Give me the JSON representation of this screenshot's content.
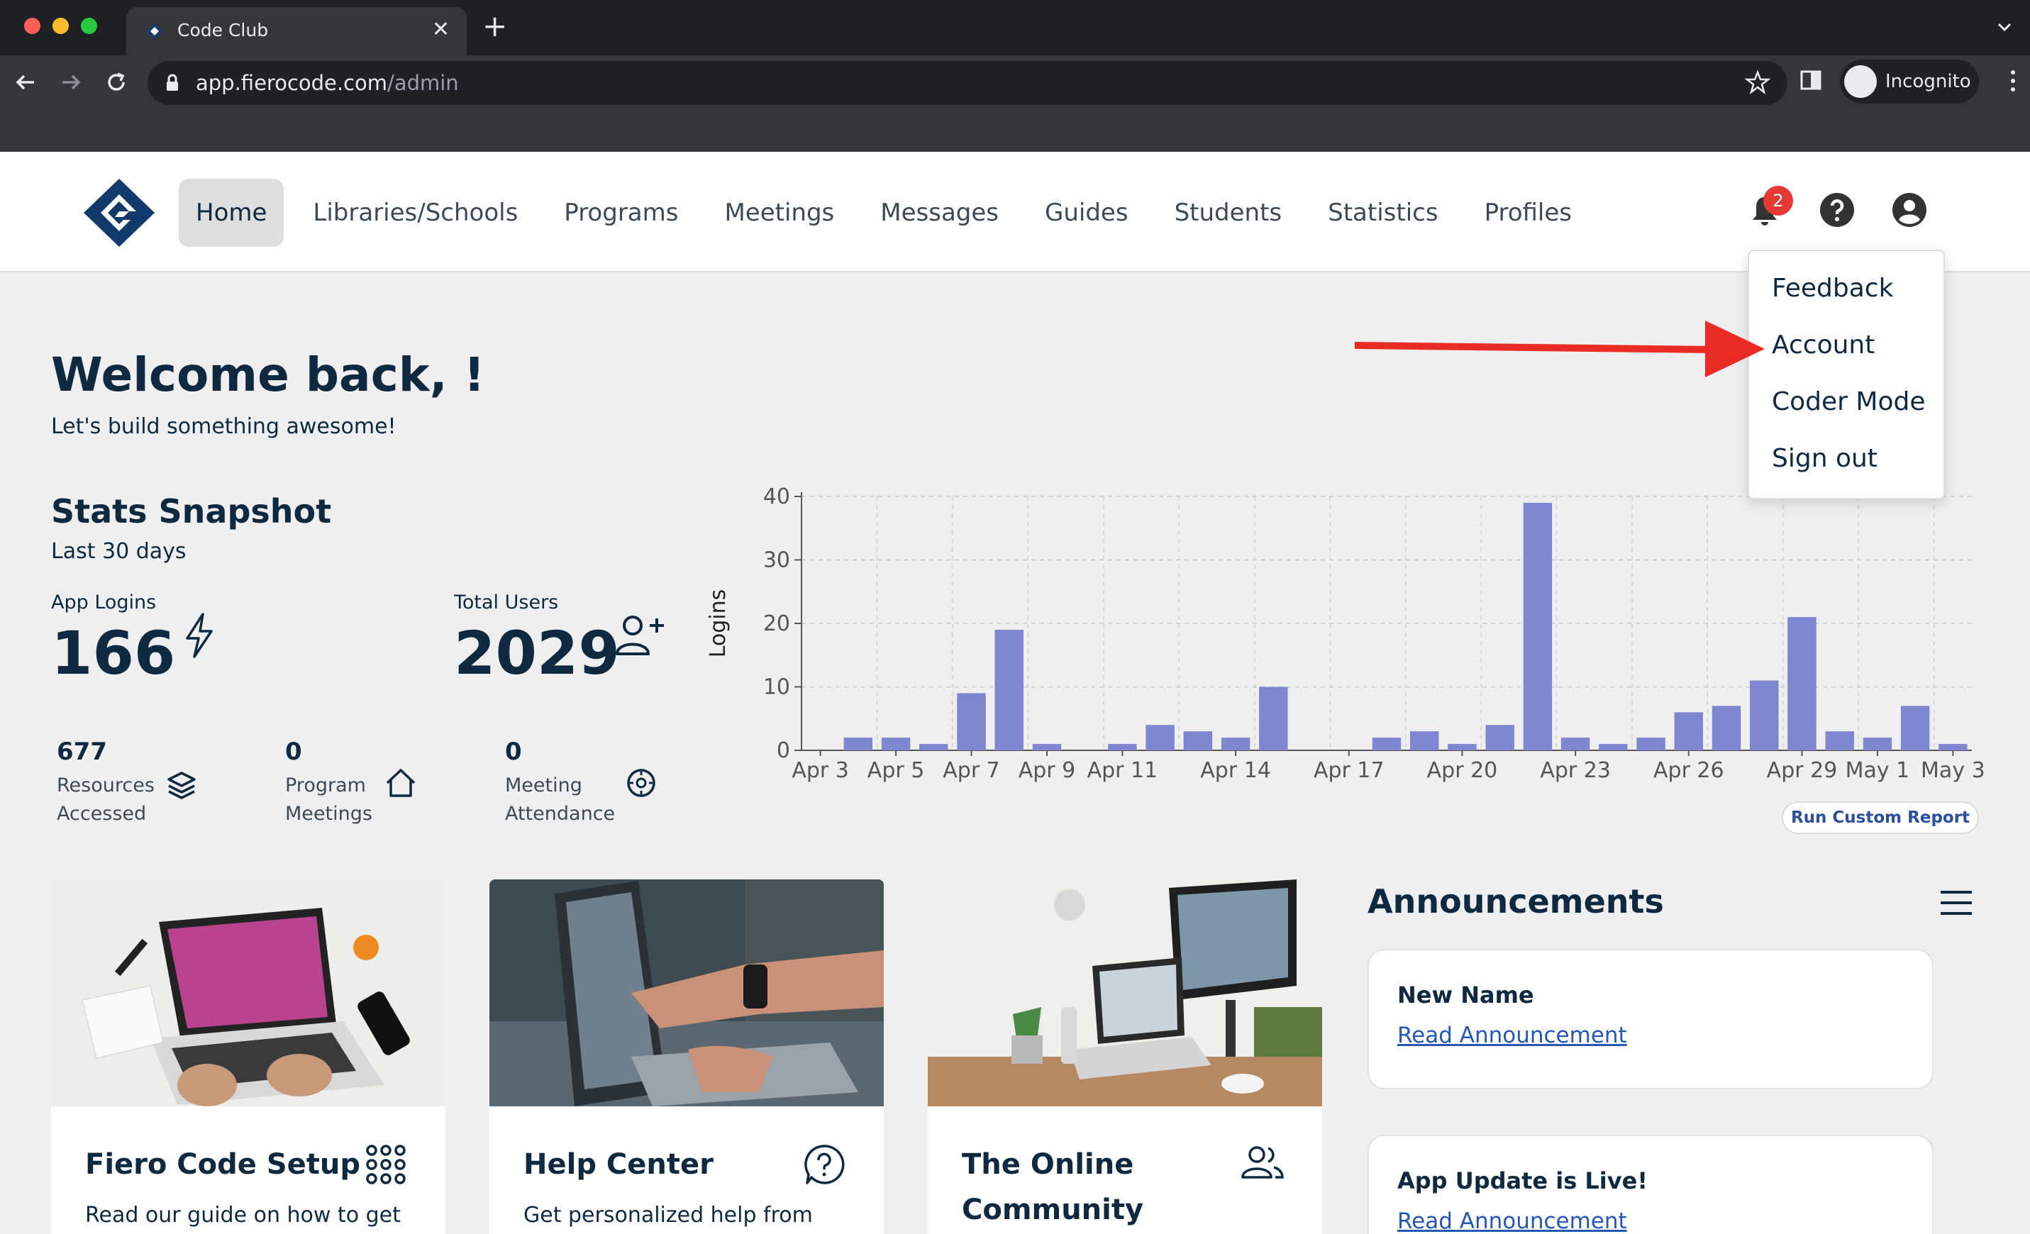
{
  "browser": {
    "tab_title": "Code Club",
    "url_host": "app.fierocode.com",
    "url_path": "/admin",
    "profile_label": "Incognito"
  },
  "nav": {
    "items": [
      "Home",
      "Libraries/Schools",
      "Programs",
      "Meetings",
      "Messages",
      "Guides",
      "Students",
      "Statistics",
      "Profiles"
    ],
    "active": "Home",
    "notification_count": "2"
  },
  "profile_menu": {
    "items": [
      "Feedback",
      "Account",
      "Coder Mode",
      "Sign out"
    ]
  },
  "welcome": {
    "title": "Welcome back, !",
    "subtitle": "Let's build something awesome!"
  },
  "stats": {
    "title": "Stats Snapshot",
    "period": "Last 30 days",
    "app_logins_label": "App Logins",
    "app_logins_value": "166",
    "total_users_label": "Total Users",
    "total_users_value": "2029",
    "resources_value": "677",
    "resources_label_1": "Resources",
    "resources_label_2": "Accessed",
    "program_meetings_value": "0",
    "program_meetings_label_1": "Program",
    "program_meetings_label_2": "Meetings",
    "meeting_attendance_value": "0",
    "meeting_attendance_label_1": "Meeting",
    "meeting_attendance_label_2": "Attendance"
  },
  "chart_data": {
    "type": "bar",
    "ylabel": "Logins",
    "xlabel": "",
    "ylim": [
      0,
      40
    ],
    "yticks": [
      0,
      10,
      20,
      30,
      40
    ],
    "grid": true,
    "color": "#7f87d1",
    "categories": [
      "Apr 3",
      "Apr 4",
      "Apr 5",
      "Apr 6",
      "Apr 7",
      "Apr 8",
      "Apr 9",
      "Apr 10",
      "Apr 11",
      "Apr 12",
      "Apr 13",
      "Apr 14",
      "Apr 15",
      "Apr 16",
      "Apr 17",
      "Apr 18",
      "Apr 19",
      "Apr 20",
      "Apr 21",
      "Apr 22",
      "Apr 23",
      "Apr 24",
      "Apr 25",
      "Apr 26",
      "Apr 27",
      "Apr 28",
      "Apr 29",
      "Apr 30",
      "May 1",
      "May 2",
      "May 3"
    ],
    "values": [
      0,
      2,
      2,
      1,
      9,
      19,
      1,
      0,
      1,
      4,
      3,
      2,
      10,
      0,
      0,
      2,
      3,
      1,
      4,
      39,
      2,
      1,
      2,
      6,
      7,
      11,
      21,
      3,
      2,
      7,
      1
    ],
    "tick_labels": [
      "Apr 3",
      "Apr 5",
      "Apr 7",
      "Apr 9",
      "Apr 11",
      "Apr 14",
      "Apr 17",
      "Apr 20",
      "Apr 23",
      "Apr 26",
      "Apr 29",
      "May 1",
      "May 3"
    ]
  },
  "run_report_label": "Run Custom Report",
  "cards": [
    {
      "title": "Fiero Code Setup",
      "text": "Read our guide on how to get",
      "icon": "apps-grid-icon"
    },
    {
      "title": "Help Center",
      "text": "Get personalized help from",
      "icon": "question-circle-icon"
    },
    {
      "title": "The Online Community",
      "title_1": "The Online",
      "title_2": "Community",
      "text": "",
      "icon": "users-icon"
    }
  ],
  "announcements": {
    "title": "Announcements",
    "items": [
      {
        "heading": "New Name",
        "link": "Read Announcement"
      },
      {
        "heading": "App Update is Live!",
        "link": "Read Announcement"
      }
    ]
  },
  "colors": {
    "brand_dark": "#0f2a40",
    "bar": "#7f87d1",
    "annotation_arrow": "#e82b25",
    "badge": "#e53935",
    "link": "#2457b8"
  }
}
